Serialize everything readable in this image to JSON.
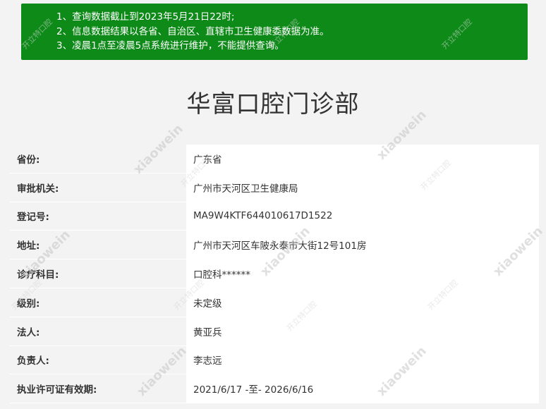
{
  "notice": {
    "lines": [
      "1、查询数据截止到2023年5月21日22时;",
      "2、信息数据结果以各省、自治区、直辖市卫生健康委数据为准。",
      "3、凌晨1点至凌晨5点系统进行维护，不能提供查询。"
    ]
  },
  "title": "华富口腔门诊部",
  "rows": [
    {
      "label": "省份:",
      "value": "广东省"
    },
    {
      "label": "审批机关:",
      "value": "广州市天河区卫生健康局"
    },
    {
      "label": "登记号:",
      "value": "MA9W4KTF644010617D1522"
    },
    {
      "label": "地址:",
      "value": "广州市天河区车陂永泰市大街12号101房"
    },
    {
      "label": "诊疗科目:",
      "value": "口腔科******"
    },
    {
      "label": "级别:",
      "value": "未定级"
    },
    {
      "label": "法人:",
      "value": "黄亚兵"
    },
    {
      "label": "负责人:",
      "value": "李志远"
    },
    {
      "label": "执业许可证有效期:",
      "value": "2021/6/17 -至- 2026/6/16"
    }
  ],
  "watermark": {
    "latin": "xiaowein",
    "cn": "开立特口腔",
    "cn_sub": "kclete.com"
  },
  "colors": {
    "notice_bg": "#0d8a18",
    "page_bg": "#f3f3f3",
    "value_bg": "#ffffff"
  }
}
